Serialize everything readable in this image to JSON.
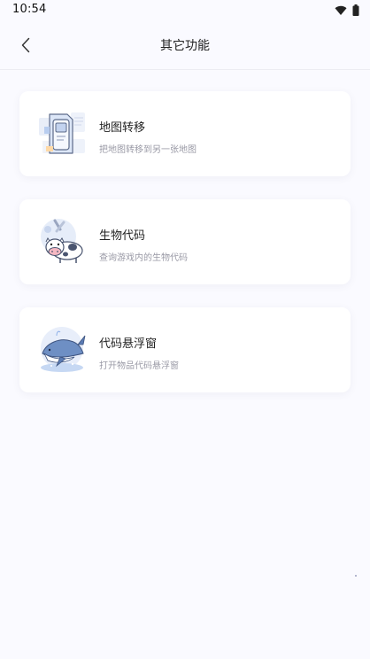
{
  "status_bar": {
    "time": "10:54"
  },
  "header": {
    "title": "其它功能",
    "back_icon": "chevron-left-icon"
  },
  "features": [
    {
      "title": "地图转移",
      "subtitle": "把地图转移到另一张地图",
      "icon": "map-transfer-icon"
    },
    {
      "title": "生物代码",
      "subtitle": "查询游戏内的生物代码",
      "icon": "cow-creature-icon"
    },
    {
      "title": "代码悬浮窗",
      "subtitle": "打开物品代码悬浮窗",
      "icon": "whale-float-icon"
    }
  ],
  "colors": {
    "background": "#fafaff",
    "card": "#ffffff",
    "subtitle": "#9a9aa6",
    "accent": "#8fb0e8"
  }
}
